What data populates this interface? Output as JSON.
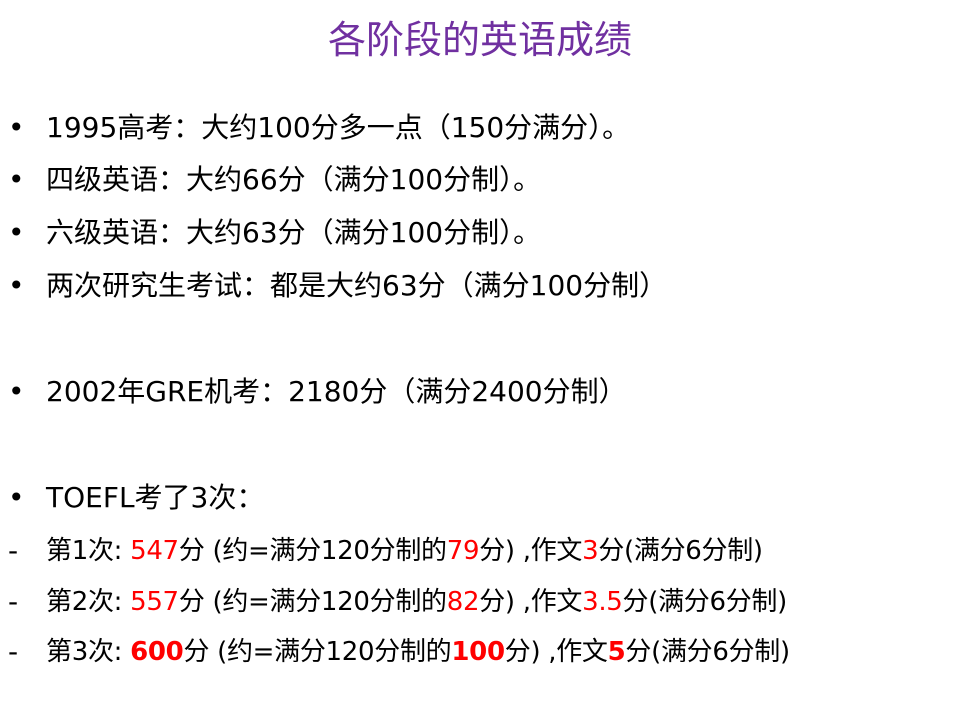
{
  "title": "各阶段的英语成绩",
  "colors": {
    "title": "#7030A0",
    "highlight": "#FF0000",
    "text": "#000000"
  },
  "bullets": [
    {
      "marker": "•",
      "text": "1995高考：大约100分多一点（150分满分）。"
    },
    {
      "marker": "•",
      "text": "四级英语：大约66分（满分100分制）。"
    },
    {
      "marker": "•",
      "text": "六级英语：大约63分（满分100分制）。"
    },
    {
      "marker": "•",
      "text": "两次研究生考试：都是大约63分（满分100分制）"
    },
    {
      "marker": "•",
      "text": "2002年GRE机考：2180分（满分2400分制）"
    },
    {
      "marker": "•",
      "text": "TOEFL考了3次："
    }
  ],
  "toefl": [
    {
      "marker": "-",
      "label": "第1次: ",
      "score": "547",
      "part1": "分 (约=满分120分制的",
      "converted": "79",
      "part2": "分) ,作文",
      "essay": "3",
      "part3": "分(满分6分制)"
    },
    {
      "marker": "-",
      "label": "第2次: ",
      "score": "557",
      "part1": "分 (约=满分120分制的",
      "converted": "82",
      "part2": "分) ,作文",
      "essay": "3.5",
      "part3": "分(满分6分制)"
    },
    {
      "marker": "-",
      "label": "第3次: ",
      "score": "600",
      "part1": "分 (约=满分120分制的",
      "converted": "100",
      "part2": "分) ,作文",
      "essay": "5",
      "part3": "分(满分6分制)"
    }
  ]
}
